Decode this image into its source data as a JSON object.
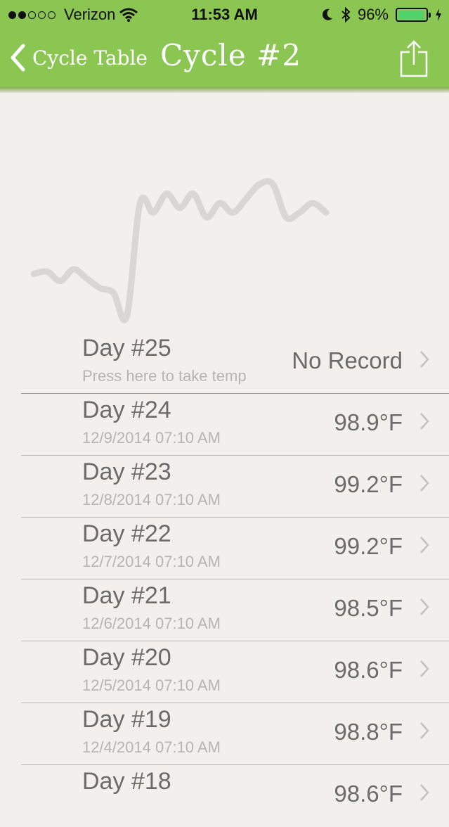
{
  "status_bar": {
    "carrier": "Verizon",
    "time": "11:53 AM",
    "battery": "96%",
    "signal_dots": [
      true,
      true,
      false,
      false,
      false
    ],
    "battery_level": 0.96
  },
  "nav": {
    "back_label": "Cycle Table",
    "title": "Cycle #2",
    "share_icon": "share-icon"
  },
  "colors": {
    "nav_bg": "#8bc653",
    "background": "#f3efec",
    "chart_line": "#d9d6d3"
  },
  "chart_data": {
    "type": "line",
    "series": [
      {
        "values": [
          97.3,
          97.35,
          97.15,
          97.4,
          97.2,
          97.0,
          96.9,
          96.4,
          98.8,
          98.6,
          99.0,
          98.7,
          99.0,
          98.5,
          98.8,
          98.6,
          98.9,
          99.2,
          99.2,
          98.5,
          98.6,
          98.8,
          98.6
        ]
      }
    ]
  },
  "rows": [
    {
      "day": "Day #25",
      "sub": "Press here to take temp",
      "value": "No Record"
    },
    {
      "day": "Day #24",
      "sub": "12/9/2014 07:10 AM",
      "value": "98.9°F"
    },
    {
      "day": "Day #23",
      "sub": "12/8/2014 07:10 AM",
      "value": "99.2°F"
    },
    {
      "day": "Day #22",
      "sub": "12/7/2014 07:10 AM",
      "value": "99.2°F"
    },
    {
      "day": "Day #21",
      "sub": "12/6/2014 07:10 AM",
      "value": "98.5°F"
    },
    {
      "day": "Day #20",
      "sub": "12/5/2014 07:10 AM",
      "value": "98.6°F"
    },
    {
      "day": "Day #19",
      "sub": "12/4/2014 07:10 AM",
      "value": "98.8°F"
    },
    {
      "day": "Day #18",
      "sub": "",
      "value": "98.6°F"
    }
  ]
}
